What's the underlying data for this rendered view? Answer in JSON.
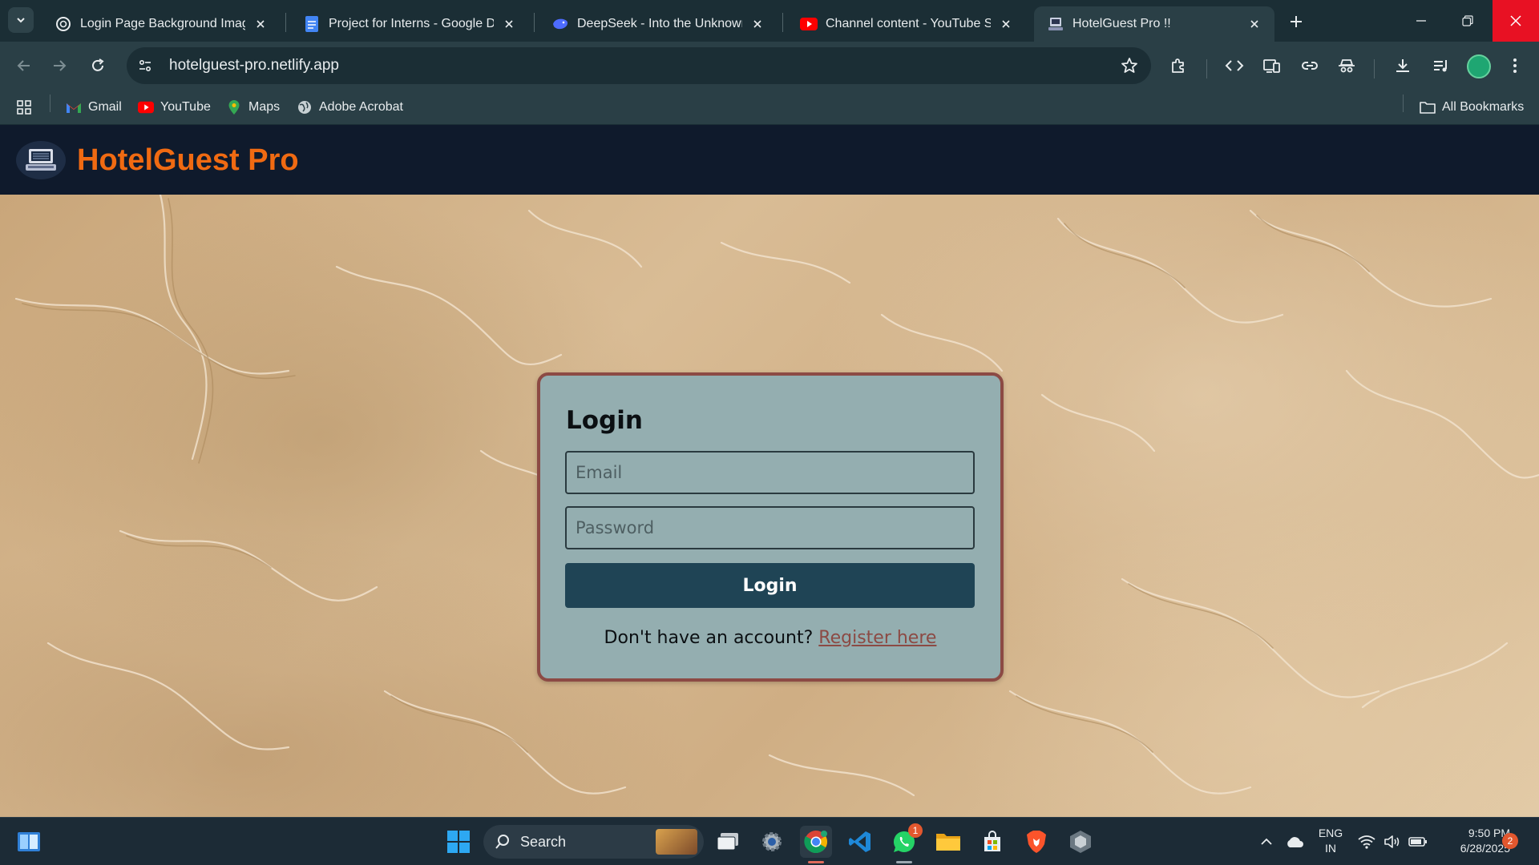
{
  "browser": {
    "tabs": [
      {
        "title": "Login Page Background Image",
        "icon": "chatgpt-icon",
        "active": false
      },
      {
        "title": "Project for Interns - Google Docs",
        "icon": "google-docs-icon",
        "active": false
      },
      {
        "title": "DeepSeek - Into the Unknown",
        "icon": "deepseek-icon",
        "active": false
      },
      {
        "title": "Channel content - YouTube Studio",
        "icon": "youtube-icon",
        "active": false
      },
      {
        "title": "HotelGuest Pro !!",
        "icon": "hotel-icon",
        "active": true
      }
    ],
    "address": {
      "url": "hotelguest-pro.netlify.app"
    },
    "bookmarks": [
      {
        "label": "Gmail",
        "icon": "gmail-icon"
      },
      {
        "label": "YouTube",
        "icon": "youtube-icon"
      },
      {
        "label": "Maps",
        "icon": "maps-icon"
      },
      {
        "label": "Adobe Acrobat",
        "icon": "globe-icon"
      }
    ],
    "all_bookmarks_label": "All Bookmarks"
  },
  "app": {
    "title": "HotelGuest Pro",
    "brand_color": "#f06a12",
    "header_bg": "#0f1a2c"
  },
  "login": {
    "heading": "Login",
    "email_placeholder": "Email",
    "password_placeholder": "Password",
    "button_label": "Login",
    "register_prompt": "Don't have an account?",
    "register_link": "Register here",
    "card_bg": "#94aeb0",
    "card_border": "#8c4a44",
    "button_bg": "#1f4455"
  },
  "taskbar": {
    "search_label": "Search",
    "whatsapp_badge": "1",
    "language": "ENG",
    "region": "IN",
    "time": "9:50 PM",
    "date": "6/28/2025",
    "notification_count": "2"
  }
}
